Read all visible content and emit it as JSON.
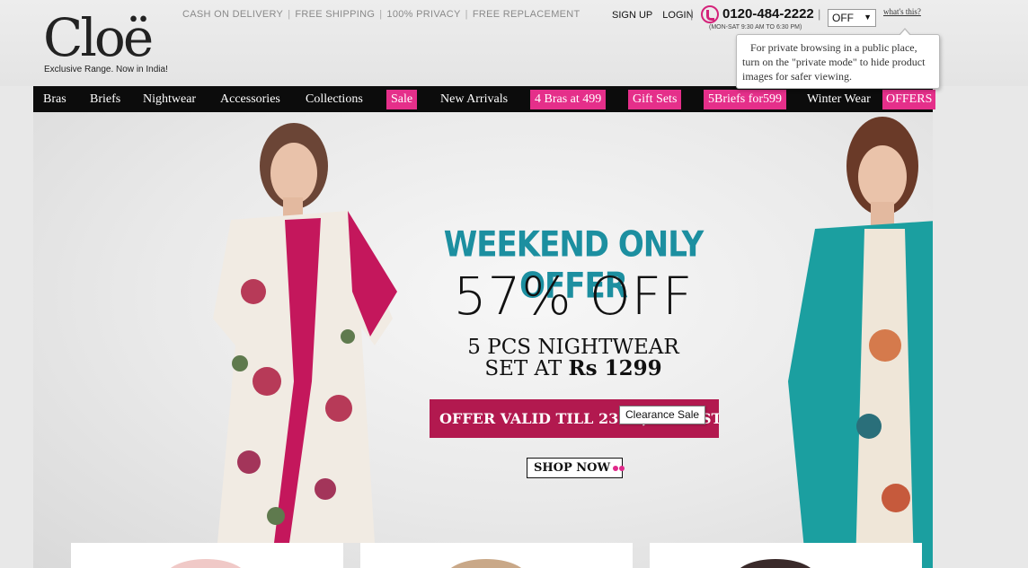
{
  "brand": {
    "logo_text": "Cloë",
    "tagline": "Exclusive Range. Now in India!"
  },
  "header": {
    "usps": [
      "CASH ON DELIVERY",
      "FREE SHIPPING",
      "100% PRIVACY",
      "FREE REPLACEMENT"
    ],
    "sign_up": "SIGN UP",
    "login": "LOGIN",
    "phone": "0120-484-2222",
    "phone_hours": "(MON-SAT 9:30 AM TO 6:30 PM)",
    "private_mode_value": "OFF",
    "whats_this": "what's this?",
    "private_tooltip": "For private browsing in a public place, turn on the \"private mode\" to hide product images for safer viewing."
  },
  "nav": {
    "items": [
      {
        "label": "Bras",
        "highlight": false
      },
      {
        "label": "Briefs",
        "highlight": false
      },
      {
        "label": "Nightwear",
        "highlight": false
      },
      {
        "label": "Accessories",
        "highlight": false
      },
      {
        "label": "Collections",
        "highlight": false
      },
      {
        "label": "Sale",
        "highlight": true
      },
      {
        "label": "New Arrivals",
        "highlight": false
      },
      {
        "label": "4 Bras at 499",
        "highlight": true
      },
      {
        "label": "Gift Sets",
        "highlight": true
      },
      {
        "label": "5Briefs for599",
        "highlight": true
      },
      {
        "label": "Winter Wear",
        "highlight": false
      },
      {
        "label": "OFFERS",
        "highlight": true
      }
    ]
  },
  "hero": {
    "headline": "WEEKEND ONLY OFFER",
    "discount": "57% OFF",
    "line1": "5 PCS NIGHTWEAR",
    "line2_prefix": "SET AT",
    "line2_price": "Rs 1299",
    "validity": "OFFER VALID TILL 23RD, AUGUST",
    "tooltip": "Clearance Sale",
    "cta": "SHOP NOW"
  },
  "colors": {
    "accent_pink": "#e52f8a",
    "teal_headline": "#1c8fa0",
    "banner_maroon": "#b2194f",
    "nav_bg": "#0c0c0c"
  }
}
